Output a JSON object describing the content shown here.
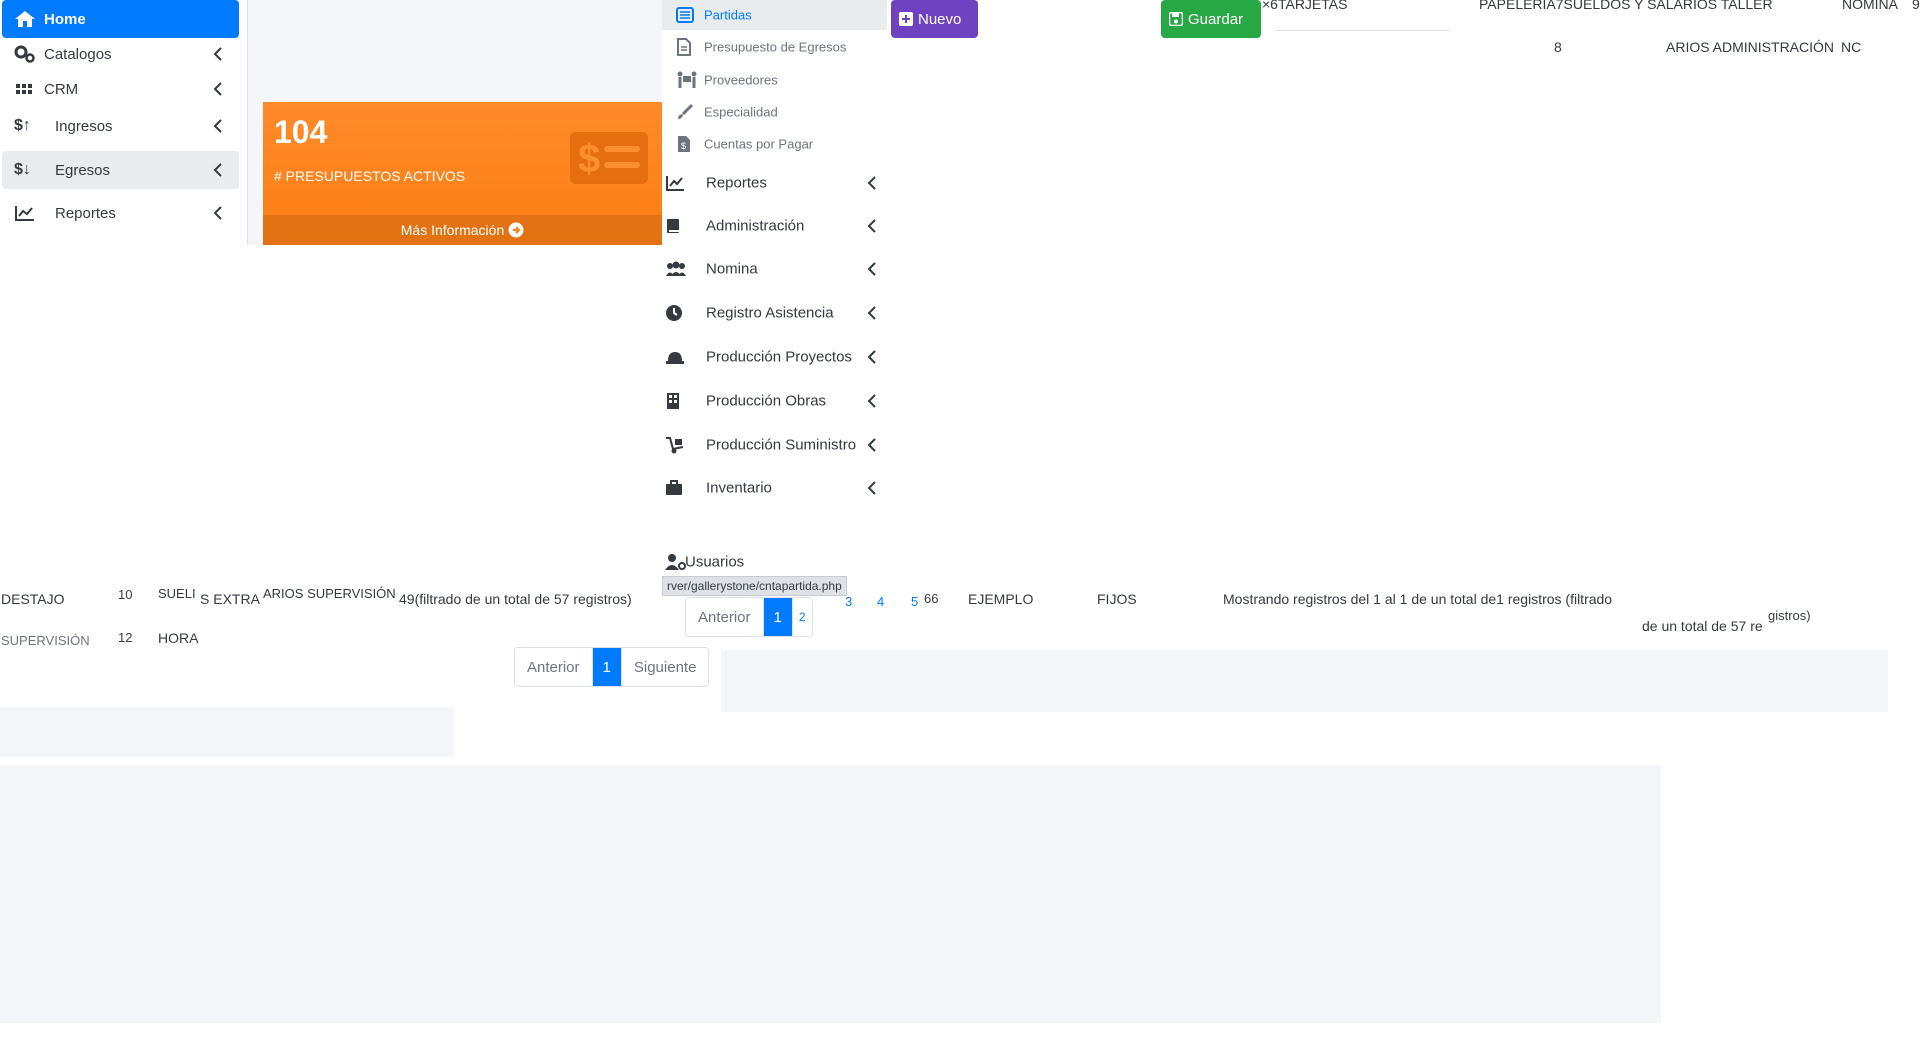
{
  "sidebar_left": {
    "items": [
      {
        "label": "Home",
        "icon": "home-icon",
        "active": true
      },
      {
        "label": "Catalogos",
        "icon": "cogs-icon"
      },
      {
        "label": "CRM",
        "icon": "grid-icon"
      },
      {
        "label": "Ingresos",
        "icon": "dollar-up-icon"
      },
      {
        "label": "Egresos",
        "icon": "dollar-down-icon"
      },
      {
        "label": "Reportes",
        "icon": "chart-line-icon"
      }
    ]
  },
  "info_box": {
    "number": "104",
    "label": "# PRESUPUESTOS ACTIVOS",
    "footer": "Más Información"
  },
  "menu": {
    "sub_items": [
      {
        "label": "Partidas",
        "icon": "list-icon",
        "active": true
      },
      {
        "label": "Presupuesto de Egresos",
        "icon": "file-icon"
      },
      {
        "label": "Proveedores",
        "icon": "people-carry-icon"
      },
      {
        "label": "Especialidad",
        "icon": "brush-icon"
      },
      {
        "label": "Cuentas por Pagar",
        "icon": "file-invoice-icon"
      }
    ],
    "items": [
      {
        "label": "Reportes",
        "icon": "chart-line-icon"
      },
      {
        "label": "Administración",
        "icon": "book-icon"
      },
      {
        "label": "Nomina",
        "icon": "users-icon"
      },
      {
        "label": "Registro Asistencia",
        "icon": "clock-icon"
      },
      {
        "label": "Producción Proyectos",
        "icon": "hard-hat-icon"
      },
      {
        "label": "Producción Obras",
        "icon": "building-icon"
      },
      {
        "label": "Producción Suministro",
        "icon": "dolly-icon"
      },
      {
        "label": "Inventario",
        "icon": "briefcase-icon"
      }
    ],
    "usuarios": "Usuarios"
  },
  "buttons": {
    "nuevo": "Nuevo",
    "guardar": "Guardar"
  },
  "top_fragments": {
    "tarjetas": "×6TARJETAS",
    "papeleria": "PAPELERIA7SUELDOS Y SALARIOS TALLER",
    "nomina": "NOMINA",
    "nine": "9",
    "eight": "8",
    "admin": "ARIOS ADMINISTRACIÓN",
    "nc": "NC"
  },
  "mid_fragments": {
    "destajo": "DESTAJO",
    "ten": "10",
    "sueldo": "SUELI",
    "extra": "S EXTRA",
    "supervision": "ARIOS SUPERVISIÓN",
    "filtered": "49(filtrado de un total de 57 registros)",
    "sixty_six": "66",
    "ejemplo": "EJEMPLO",
    "fijos": "FIJOS",
    "mostrando": "Mostrando registros del 1 al 1 de un total de1 registros (filtrado",
    "de_un_total": "de un total de 57 re",
    "gistros": "gistros)",
    "supervision2": "SUPERVISIÓN",
    "twelve": "12",
    "hora": "HORA"
  },
  "pager_a": {
    "prev": "Anterior",
    "current": "1",
    "pages": [
      "2",
      "3",
      "4",
      "5"
    ]
  },
  "pager_b": {
    "prev": "Anterior",
    "current": "1",
    "next": "Siguiente"
  },
  "status_url": "rver/gallerystone/cntapartida.php",
  "colors": {
    "primary": "#007bff",
    "orange": "#fd7e14",
    "purple": "#6f42c1",
    "green": "#28a745",
    "grey_bg": "#f4f6f9"
  }
}
